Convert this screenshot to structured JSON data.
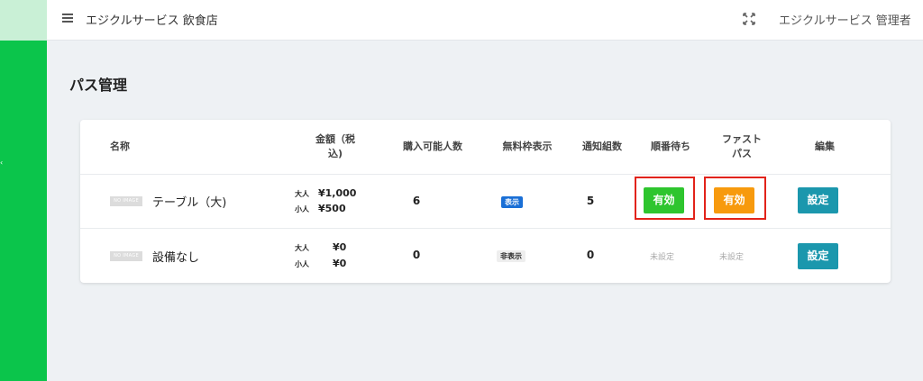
{
  "header": {
    "shop_name": "エジクルサービス 飲食店",
    "admin_name": "エジクルサービス 管理者"
  },
  "page": {
    "title": "パス管理"
  },
  "table": {
    "columns": {
      "name": "名称",
      "price_line1": "金額（税",
      "price_line2": "込)",
      "purchasable": "購入可能人数",
      "free_slot": "無料枠表示",
      "notify": "通知組数",
      "queue": "順番待ち",
      "fastpass_line1": "ファスト",
      "fastpass_line2": "パス",
      "edit": "編集"
    },
    "rows": [
      {
        "image": "NO IMAGE",
        "name": "テーブル（大)",
        "adult_label": "大人",
        "adult_price": "¥1,000",
        "child_label": "小人",
        "child_price": "¥500",
        "purchasable": "6",
        "free_slot": "表示",
        "notify": "5",
        "queue": "有効",
        "fastpass": "有効",
        "edit": "設定"
      },
      {
        "image": "NO IMAGE",
        "name": "設備なし",
        "adult_label": "大人",
        "adult_price": "¥0",
        "child_label": "小人",
        "child_price": "¥0",
        "purchasable": "0",
        "free_slot": "非表示",
        "notify": "0",
        "queue": "未設定",
        "fastpass": "未設定",
        "edit": "設定"
      }
    ]
  },
  "colors": {
    "sidebar": "#0bc54b",
    "queue_valid": "#2ec52e",
    "fastpass_valid": "#f79a0e",
    "setting_button": "#1b97ad",
    "highlight": "#e2231a"
  }
}
